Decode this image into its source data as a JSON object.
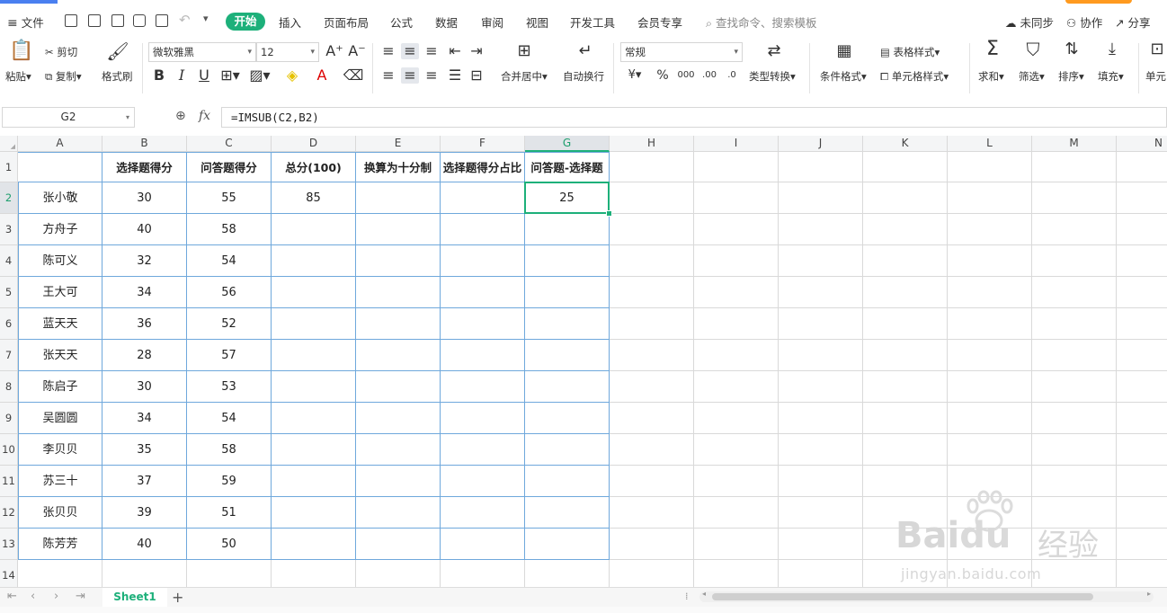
{
  "menubar": {
    "file_label": "文件",
    "tabs": [
      "开始",
      "插入",
      "页面布局",
      "公式",
      "数据",
      "审阅",
      "视图",
      "开发工具",
      "会员专享"
    ],
    "search_placeholder": "查找命令、搜索模板",
    "sync_label": "未同步",
    "collab_label": "协作",
    "share_label": "分享"
  },
  "ribbon": {
    "paste_label": "粘贴",
    "cut_label": "剪切",
    "copy_label": "复制",
    "format_painter_label": "格式刷",
    "font_name": "微软雅黑",
    "font_size": "12",
    "merge_label": "合并居中",
    "wrap_label": "自动换行",
    "number_format": "常规",
    "type_convert_label": "类型转换",
    "cond_format_label": "条件格式",
    "table_style_label": "表格样式",
    "cell_style_label": "单元格样式",
    "sum_label": "求和",
    "filter_label": "筛选",
    "sort_label": "排序",
    "fill_label": "填充",
    "cell_label": "单元"
  },
  "formula_bar": {
    "name_box": "G2",
    "fx_label": "fx",
    "formula": "=IMSUB(C2,B2)"
  },
  "sheet": {
    "columns": [
      "A",
      "B",
      "C",
      "D",
      "E",
      "F",
      "G",
      "H",
      "I",
      "J",
      "K",
      "L",
      "M",
      "N"
    ],
    "selected_column": "G",
    "selected_row": 2,
    "row_numbers": [
      "1",
      "2",
      "3",
      "4",
      "5",
      "6",
      "7",
      "8",
      "9",
      "10",
      "11",
      "12",
      "13",
      "14"
    ],
    "header_row": [
      "",
      "选择题得分",
      "问答题得分",
      "总分(100)",
      "换算为十分制",
      "选择题得分占比",
      "问答题-选择题"
    ],
    "rows": [
      [
        "张小敬",
        "30",
        "55",
        "85",
        "",
        "",
        "25"
      ],
      [
        "方舟子",
        "40",
        "58",
        "",
        "",
        "",
        ""
      ],
      [
        "陈可义",
        "32",
        "54",
        "",
        "",
        "",
        ""
      ],
      [
        "王大可",
        "34",
        "56",
        "",
        "",
        "",
        ""
      ],
      [
        "蓝天天",
        "36",
        "52",
        "",
        "",
        "",
        ""
      ],
      [
        "张天天",
        "28",
        "57",
        "",
        "",
        "",
        ""
      ],
      [
        "陈启子",
        "30",
        "53",
        "",
        "",
        "",
        ""
      ],
      [
        "吴圆圆",
        "34",
        "54",
        "",
        "",
        "",
        ""
      ],
      [
        "李贝贝",
        "35",
        "58",
        "",
        "",
        "",
        ""
      ],
      [
        "苏三十",
        "37",
        "59",
        "",
        "",
        "",
        ""
      ],
      [
        "张贝贝",
        "39",
        "51",
        "",
        "",
        "",
        ""
      ],
      [
        "陈芳芳",
        "40",
        "50",
        "",
        "",
        "",
        ""
      ]
    ]
  },
  "sheet_bar": {
    "sheet_name": "Sheet1"
  },
  "watermark": {
    "brand": "Bai",
    "brand2": "du",
    "cn": "经验",
    "url": "jingyan.baidu.com"
  }
}
